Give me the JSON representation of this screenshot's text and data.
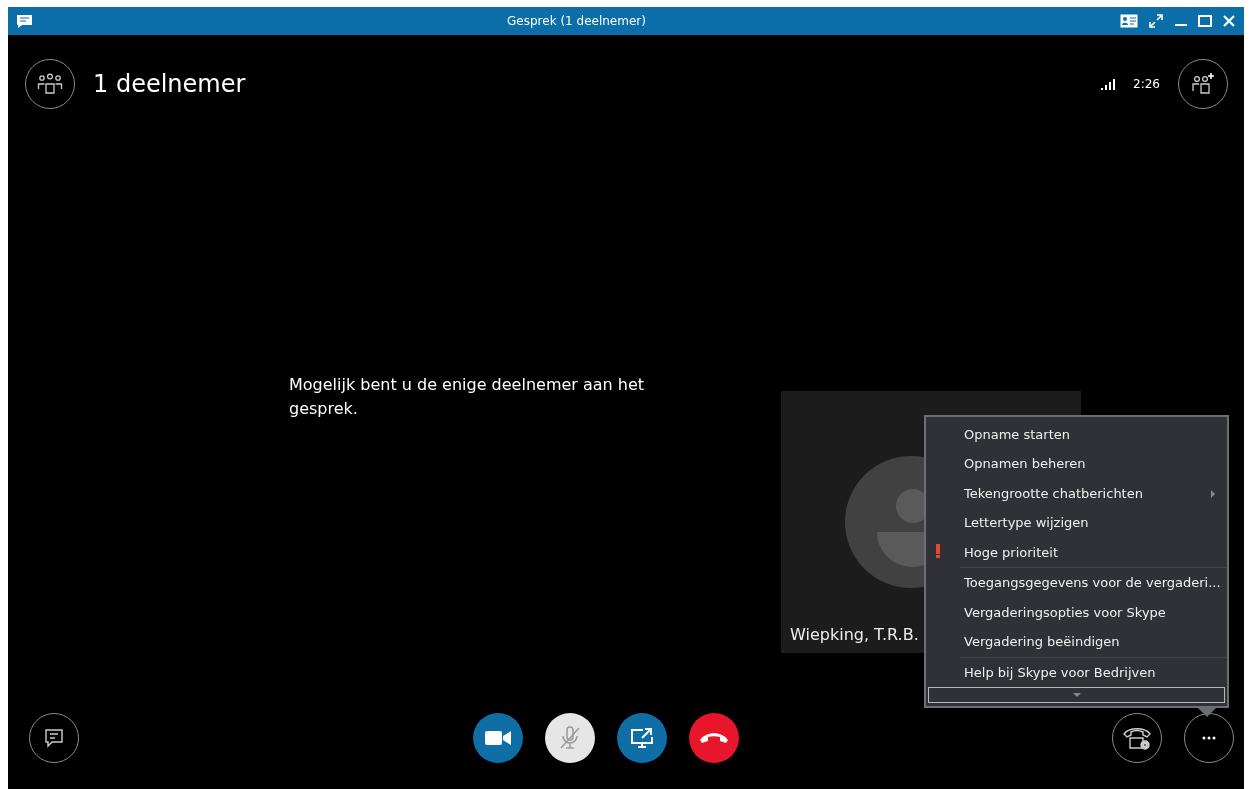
{
  "window": {
    "title": "Gesprek (1 deelnemer)"
  },
  "header": {
    "participants": "1 deelnemer",
    "duration": "2:26"
  },
  "stage": {
    "message": "Mogelijk bent u de enige deelnemer aan het gesprek.",
    "self_view": {
      "name": "Wiepking, T.R.B."
    }
  },
  "menu": {
    "items": [
      {
        "label": "Opname starten",
        "kind": "plain",
        "separator_before": false
      },
      {
        "label": "Opnamen beheren",
        "kind": "plain",
        "separator_before": false
      },
      {
        "label": "Tekengrootte chatberichten",
        "kind": "submenu",
        "separator_before": false
      },
      {
        "label": "Lettertype wijzigen",
        "kind": "plain",
        "separator_before": false
      },
      {
        "label": "Hoge prioriteit",
        "kind": "flag",
        "separator_before": false
      },
      {
        "label": "Toegangsgegevens voor de vergaderi...",
        "kind": "plain",
        "separator_before": true
      },
      {
        "label": "Vergaderingsopties voor Skype",
        "kind": "plain",
        "separator_before": false
      },
      {
        "label": "Vergadering beëindigen",
        "kind": "plain",
        "separator_before": false
      },
      {
        "label": "Help bij Skype voor Bedrijven",
        "kind": "plain",
        "separator_before": true
      }
    ]
  },
  "toolbar": {
    "controls": [
      {
        "kind": "video"
      },
      {
        "kind": "mic",
        "muted": true
      },
      {
        "kind": "share"
      },
      {
        "kind": "hangup"
      }
    ]
  }
}
